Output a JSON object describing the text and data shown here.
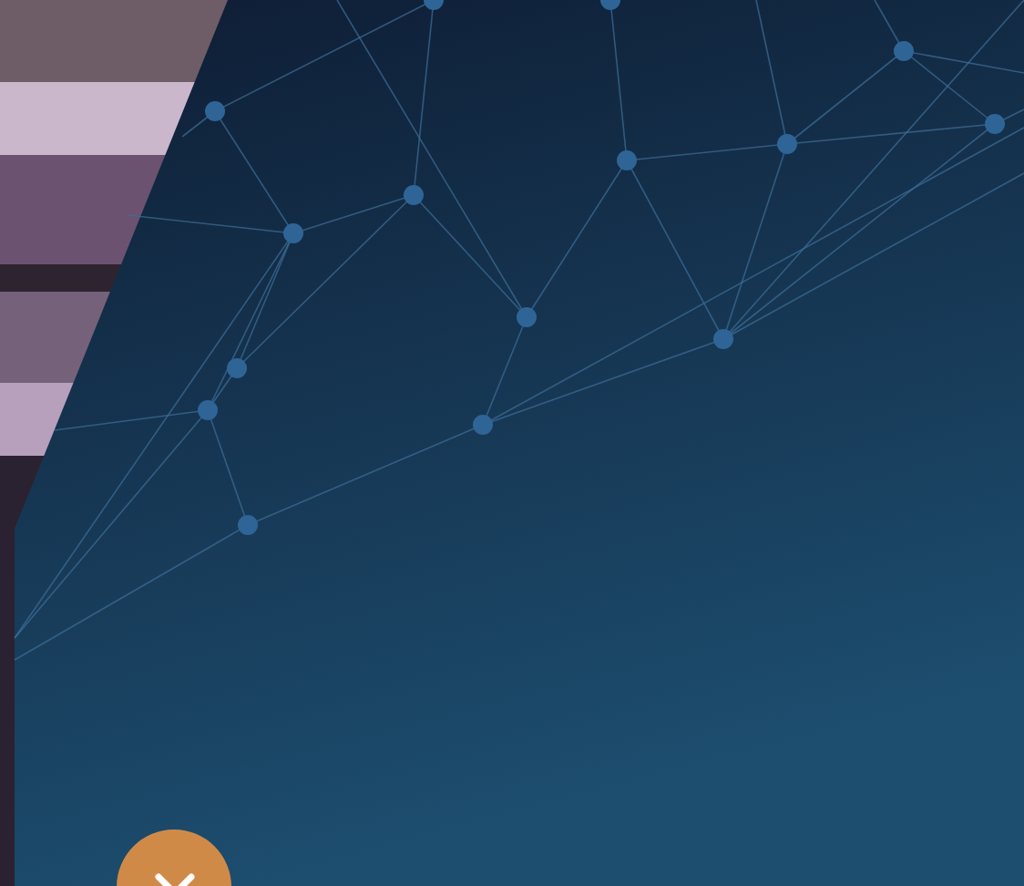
{
  "hero": {
    "network": {
      "kind": "network"
    },
    "close_button": {
      "kind": "close"
    }
  }
}
